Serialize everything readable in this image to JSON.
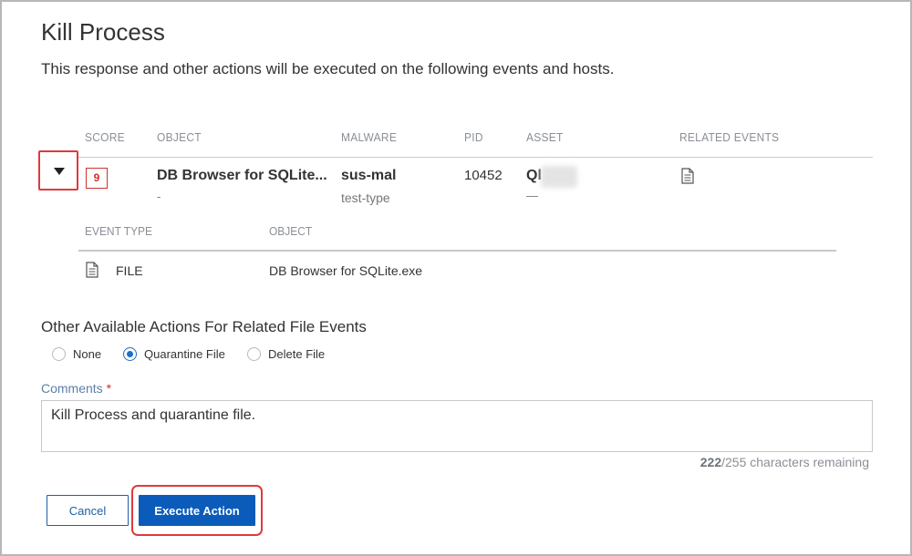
{
  "dialog": {
    "title": "Kill Process",
    "subtitle": "This response and other actions will be executed on the following events and hosts."
  },
  "table": {
    "columns": [
      "SCORE",
      "OBJECT",
      "MALWARE",
      "PID",
      "ASSET",
      "RELATED EVENTS"
    ],
    "row": {
      "score": "9",
      "object": "DB Browser for SQLite...",
      "object_sub": "-",
      "malware": "sus-mal",
      "malware_type": "test-type",
      "pid": "10452",
      "asset": "Ql",
      "asset_sub": "—"
    },
    "sub_columns": [
      "EVENT TYPE",
      "OBJECT"
    ],
    "sub_row": {
      "event_type": "FILE",
      "object": "DB Browser for SQLite.exe"
    }
  },
  "actions": {
    "title": "Other Available Actions For Related File Events",
    "options": [
      "None",
      "Quarantine File",
      "Delete File"
    ],
    "selected": "Quarantine File"
  },
  "comments": {
    "label": "Comments",
    "required_mark": "*",
    "value": "Kill Process and quarantine file.",
    "chars_used": "222",
    "chars_rest": "/255 characters remaining"
  },
  "buttons": {
    "cancel": "Cancel",
    "execute": "Execute Action"
  },
  "colors": {
    "accent": "#0b5cba",
    "highlight": "#e0393c",
    "score": "#d0302c"
  }
}
